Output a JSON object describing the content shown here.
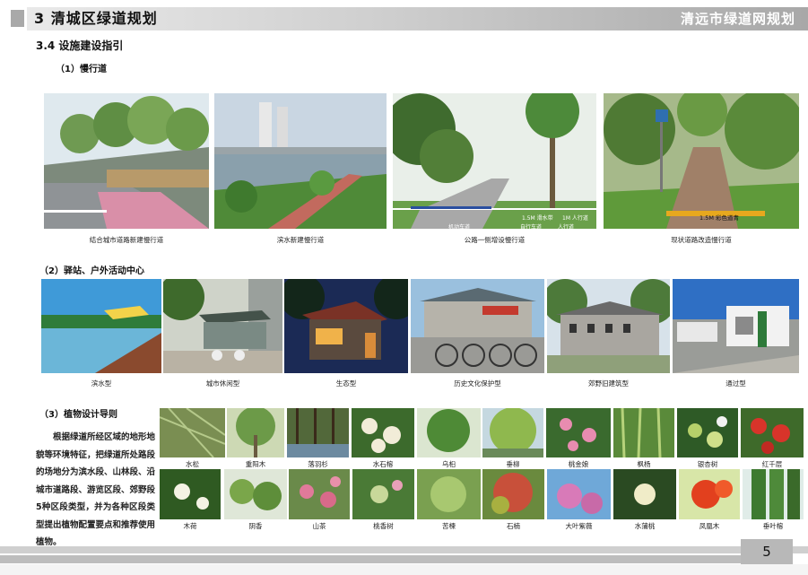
{
  "header": {
    "title": "3  清城区绿道规划",
    "right_title": "清远市绿道网规划"
  },
  "section": {
    "heading": "3.4  设施建设指引"
  },
  "slow_roads": {
    "heading": "（1）慢行道",
    "photos": [
      {
        "caption": "结合城市道路新建慢行道",
        "icon": "city-road-photo"
      },
      {
        "caption": "滨水新建慢行道",
        "icon": "waterfront-photo"
      },
      {
        "caption": "公路一侧增设慢行道",
        "icon": "highway-side-photo",
        "labels": [
          "机动车道",
          "1.5M  滑水带",
          "1M  人行道",
          "自行车道",
          "人行道"
        ]
      },
      {
        "caption": "现状道路改造慢行道",
        "icon": "rural-path-photo",
        "labels": [
          "1.5M  彩色道青"
        ]
      }
    ]
  },
  "stations": {
    "heading": "（2）驿站、户外活动中心",
    "photos": [
      {
        "caption": "滨水型",
        "icon": "waterfront-station-photo"
      },
      {
        "caption": "城市休闲型",
        "icon": "urban-leisure-photo"
      },
      {
        "caption": "生态型",
        "icon": "eco-cabin-photo"
      },
      {
        "caption": "历史文化保护型",
        "icon": "heritage-photo"
      },
      {
        "caption": "郊野旧建筑型",
        "icon": "old-building-photo"
      },
      {
        "caption": "通过型",
        "icon": "pass-through-photo"
      }
    ]
  },
  "plants": {
    "heading": "（3）植物设计导则",
    "paragraph": "根据绿道所经区域的地形地貌等环境特征，把绿道所处路段的场地分为滨水段、山林段、沿城市道路段、游览区段、郊野段5种区段类型，并为各种区段类型提出植物配置要点和推荐使用植物。",
    "row1": [
      "水松",
      "重阳木",
      "落羽杉",
      "水石榕",
      "乌桕",
      "垂柳",
      "桃金娘",
      "枫杨",
      "银杏树",
      "红千层"
    ],
    "row2": [
      "木荷",
      "阴香",
      "山茶",
      "桃香树",
      "苦楝",
      "石楠",
      "大叶紫薇",
      "水蒲桃",
      "凤凰木",
      "垂叶榕"
    ]
  },
  "footer": {
    "page_number": "5"
  }
}
